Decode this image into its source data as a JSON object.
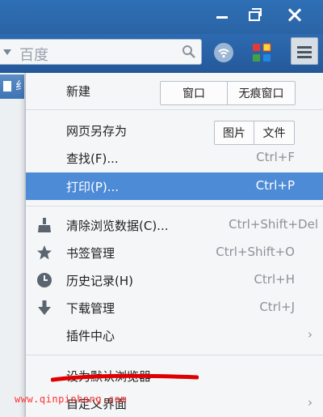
{
  "window": {
    "controls": [
      "minimize-icon",
      "restore-icon",
      "close-icon"
    ]
  },
  "toolbar": {
    "search_placeholder": "百度",
    "icons": [
      "wifi-icon",
      "apps-icon",
      "menu-icon"
    ]
  },
  "tab": {
    "partial_title": "纟"
  },
  "menu": {
    "new": {
      "label": "新建",
      "window": "窗口",
      "incognito": "无痕窗口"
    },
    "save_as": {
      "label": "网页另存为",
      "image": "图片",
      "file": "文件"
    },
    "find": {
      "label": "查找(F)...",
      "shortcut": "Ctrl+F"
    },
    "print": {
      "label": "打印(P)...",
      "shortcut": "Ctrl+P"
    },
    "clear": {
      "label": "清除浏览数据(C)...",
      "shortcut": "Ctrl+Shift+Del"
    },
    "bookmarks": {
      "label": "书签管理",
      "shortcut": "Ctrl+Shift+O"
    },
    "history": {
      "label": "历史记录(H)",
      "shortcut": "Ctrl+H"
    },
    "downloads": {
      "label": "下载管理",
      "shortcut": "Ctrl+J"
    },
    "plugins": {
      "label": "插件中心",
      "arrow": "›"
    },
    "default_browser": {
      "label": "设为默认浏览器"
    },
    "customize": {
      "label": "自定义界面",
      "arrow": "›"
    }
  },
  "watermark": "www.qinpinhang.com",
  "colors": {
    "highlight": "#4d8bd7",
    "titlebar": "#2f6fb5",
    "annotation": "#e00000"
  }
}
